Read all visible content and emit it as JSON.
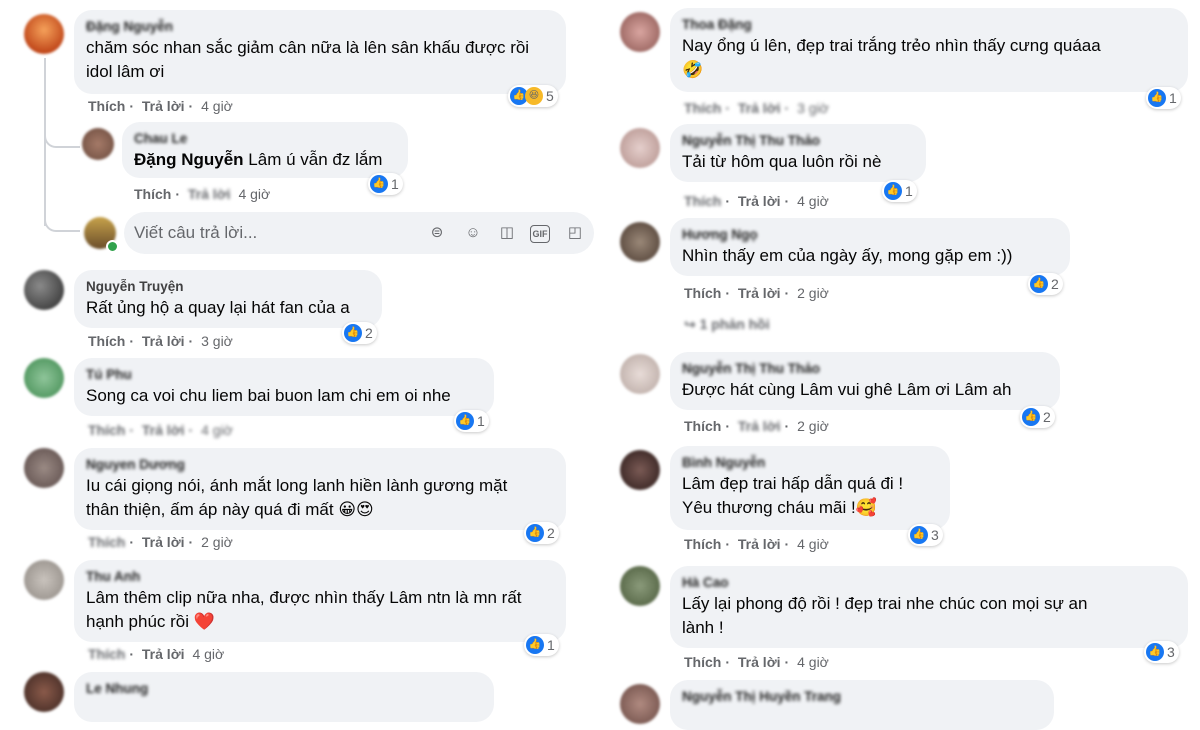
{
  "labels": {
    "like": "Thích",
    "reply": "Trả lời"
  },
  "left_comments": [
    {
      "author": "Đặng Nguyễn",
      "text": "chăm sóc nhan sắc giảm cân nữa là lên sân khấu được rồi\nidol lâm ơi",
      "time": "4 giờ",
      "reactions": "5",
      "reaction_types": [
        "like-icon",
        "haha-icon"
      ]
    },
    {
      "author": "Chau Le",
      "text": "Lâm ú vẫn đz lắm",
      "mention": "Đặng Nguyễn",
      "time": "4 giờ",
      "reactions": "1",
      "reply": true
    },
    {
      "author": "Nguyễn Truyện",
      "text": "Rất ủng hộ a quay lại hát fan của a",
      "time": "3 giờ",
      "reactions": "2"
    },
    {
      "author": "Tú Phu",
      "text": "Song ca voi chu liem bai buon lam chi em oi nhe",
      "time": "4 giờ",
      "reactions": "1"
    },
    {
      "author": "Nguyen Dương",
      "text": "Iu cái giọng nói, ánh mắt long lanh hiền lành gương mặt\nthân thiện, ấm áp này quá đi mất 😀😍",
      "time": "2 giờ",
      "reactions": "2"
    },
    {
      "author": "Thu Anh",
      "text": "Lâm thêm clip nữa nha, được nhìn thấy Lâm ntn là mn rất\nhạnh phúc rồi ❤️",
      "time": "4 giờ",
      "reactions": "1"
    },
    {
      "author": "Le Nhung",
      "text": "",
      "time": "",
      "reactions": ""
    }
  ],
  "reply_box": {
    "placeholder": "Viết câu trả lời..."
  },
  "right_comments": [
    {
      "author": "Thoa Đặng",
      "text": "Nay ổng ú lên, đẹp trai trắng trẻo nhìn thấy cưng quáaa\n🤣",
      "time": "3 giờ",
      "reactions": "1"
    },
    {
      "author": "Nguyễn Thị Thu Thảo",
      "text": "Tải từ hôm qua luôn rồi nè",
      "time": "4 giờ",
      "reactions": "1"
    },
    {
      "author": "Hương Ngọ",
      "text": "Nhìn thấy em của ngày ấy, mong gặp em :))",
      "time": "2 giờ",
      "reactions": "2",
      "more": "1 phản hồi"
    },
    {
      "author": "Nguyễn Thị Thu Thảo",
      "text": "Được hát cùng Lâm vui ghê Lâm ơi Lâm ah",
      "time": "2 giờ",
      "reactions": "2"
    },
    {
      "author": "Bình Nguyễn",
      "text": "Lâm đẹp trai hấp dẫn quá đi !\nYêu thương cháu mãi !🥰",
      "time": "4 giờ",
      "reactions": "3"
    },
    {
      "author": "Hà Cao",
      "text": "Lấy lại phong độ rồi ! đẹp trai nhe chúc con mọi sự an\nlành !",
      "time": "4 giờ",
      "reactions": "3"
    },
    {
      "author": "Nguyễn Thị Huyền Trang",
      "text": "",
      "time": "",
      "reactions": ""
    }
  ],
  "colors": {
    "like": "#1877f2",
    "bubble": "#f0f2f5",
    "meta": "#65676b"
  }
}
